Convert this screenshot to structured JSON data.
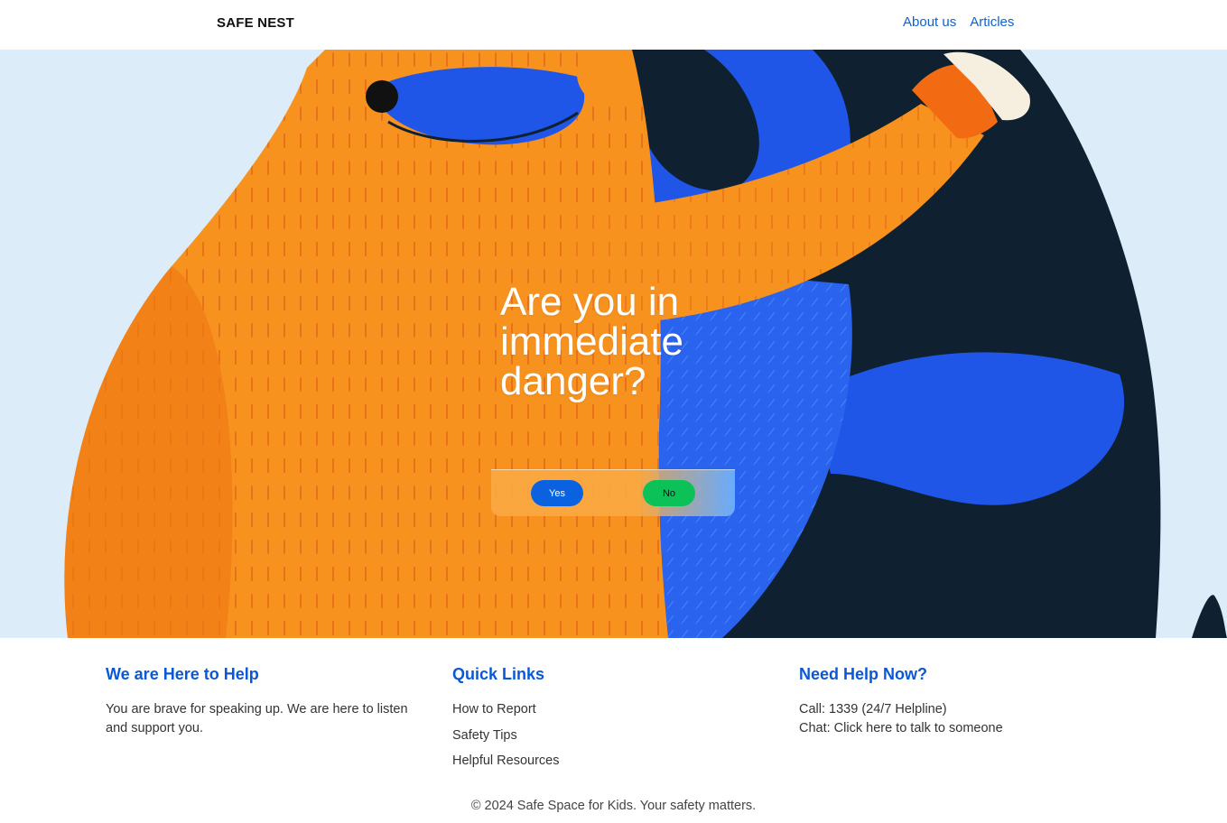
{
  "header": {
    "brand": "SAFE NEST",
    "nav": [
      "About us",
      "Articles"
    ]
  },
  "hero": {
    "question": "Are you in immediate danger?",
    "yes_label": "Yes",
    "no_label": "No"
  },
  "footer": {
    "about": {
      "title": "We are Here to Help",
      "text": "You are brave for speaking up. We are here to listen and support you."
    },
    "links": {
      "title": "Quick Links",
      "items": [
        "How to Report",
        "Safety Tips",
        "Helpful Resources"
      ]
    },
    "help": {
      "title": "Need Help Now?",
      "call": "Call: 1339 (24/7 Helpline)",
      "chat": "Chat: Click here to talk to someone"
    },
    "copyright": "© 2024 Safe Space for Kids. Your safety matters."
  },
  "colors": {
    "link": "#0a62d6",
    "yes": "#0a62e0",
    "no": "#0cc157",
    "hero_bg": "#dcedf9",
    "orange": "#f7921e",
    "blue": "#1f56e8",
    "dark": "#0f2030"
  }
}
